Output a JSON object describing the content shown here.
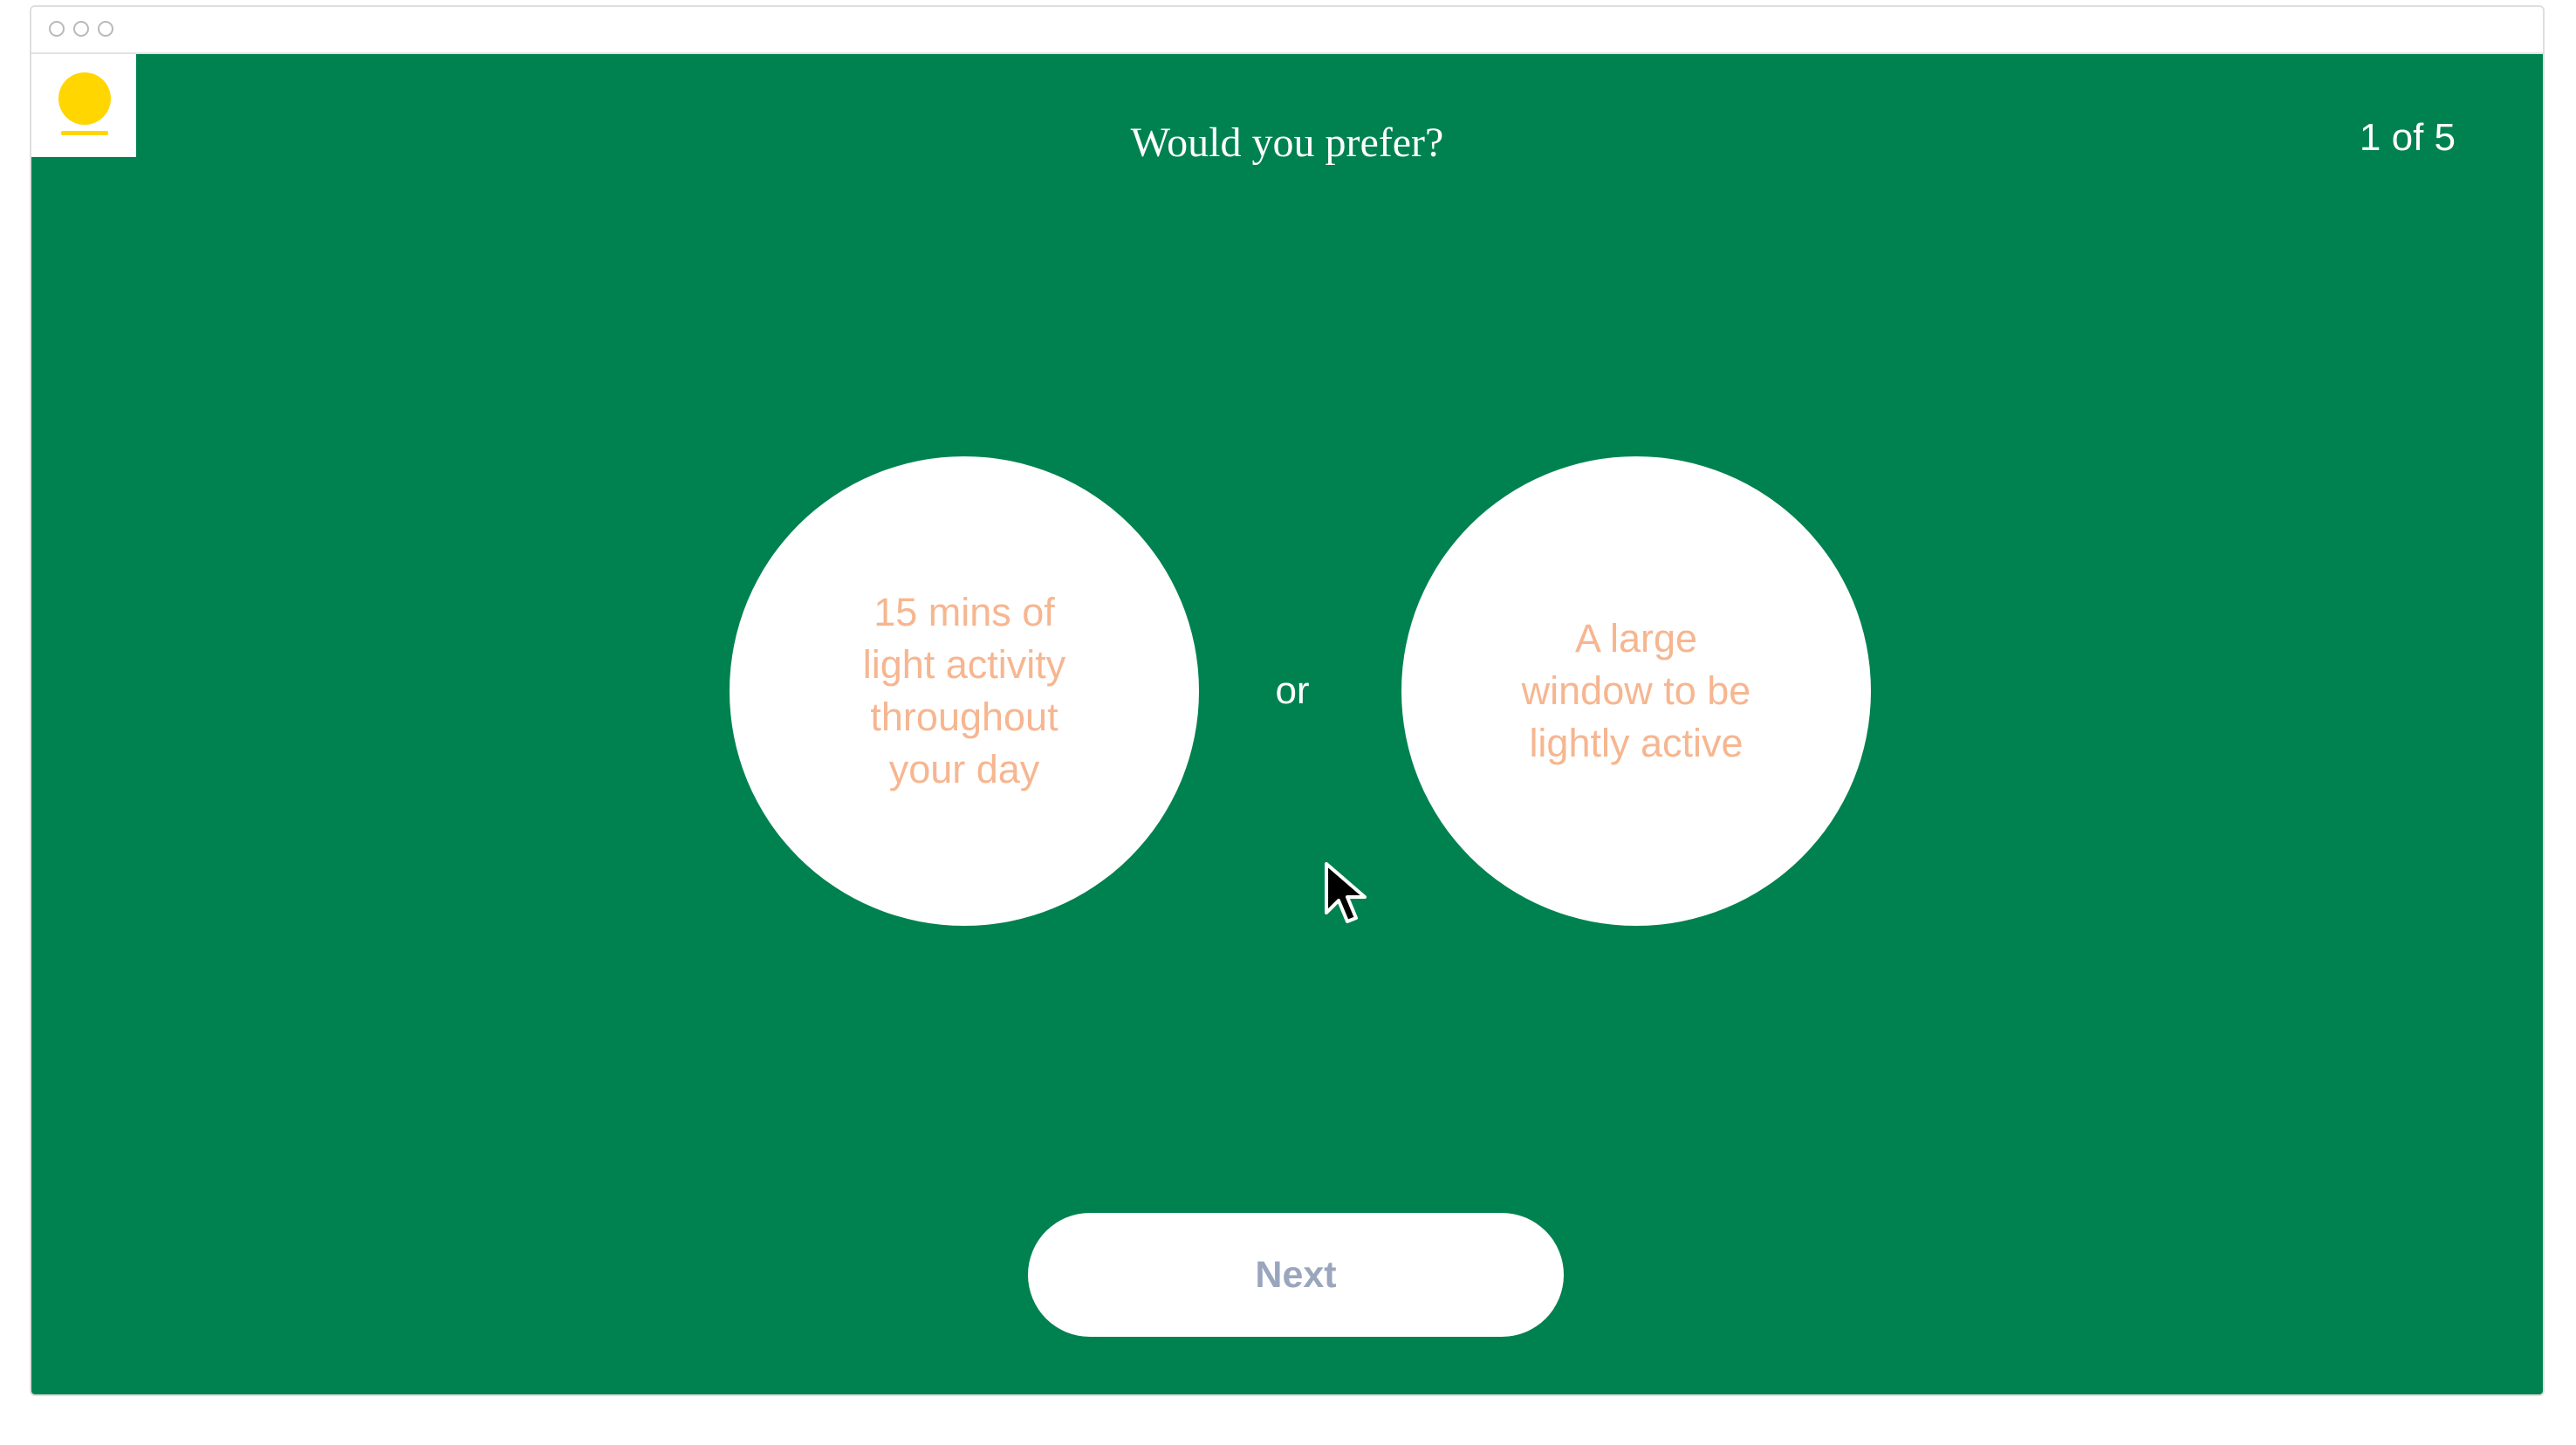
{
  "quiz": {
    "question": "Would you prefer?",
    "progress": "1 of 5",
    "options": [
      {
        "label": "15 mins of light activity throughout your day"
      },
      {
        "label": "A large window to be lightly active"
      }
    ],
    "separator": "or",
    "next_label": "Next"
  },
  "colors": {
    "background": "#008250",
    "circle": "#ffffff",
    "option_text": "#f6b690",
    "logo": "#ffd600",
    "next_text": "#9aa6bd"
  }
}
